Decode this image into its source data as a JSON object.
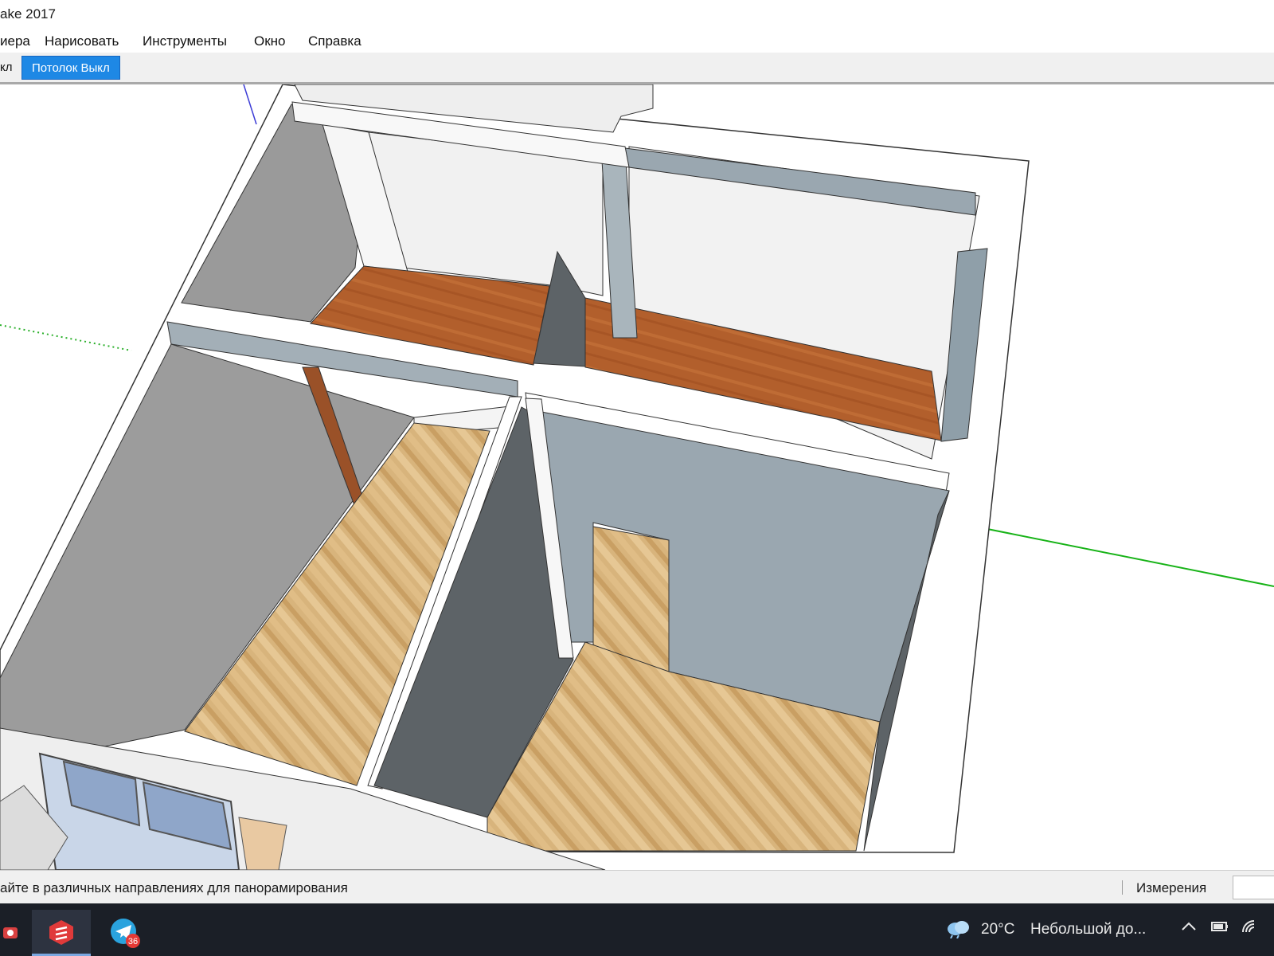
{
  "window": {
    "title": "ake 2017"
  },
  "menu": [
    {
      "label": "иера"
    },
    {
      "label": "Нарисовать"
    },
    {
      "label": "Инструменты"
    },
    {
      "label": "Окно"
    },
    {
      "label": "Справка"
    }
  ],
  "toolbar": {
    "items": [
      {
        "label": "кл"
      },
      {
        "label": "Потолок Выкл"
      }
    ]
  },
  "viewport": {
    "colors": {
      "floor_oak": "#d8b47c",
      "floor_cherry": "#b25f2c",
      "wall_top": "#ffffff",
      "wall_gray": "#9c9c9c",
      "wall_blue": "#9aa7b0",
      "wall_dark": "#5d6367",
      "axis_green": "#17b317"
    }
  },
  "status": {
    "hint": "айте в различных направлениях для панорамирования",
    "measurements_label": "Измерения",
    "measurements_value": ""
  },
  "taskbar": {
    "weather_temp": "20°C",
    "weather_text": "Небольшой до...",
    "telegram_badge": "36",
    "icons": [
      "camera-app-icon",
      "sketchup-icon",
      "telegram-icon",
      "weather-cloud-icon",
      "chevron-up-icon",
      "battery-icon",
      "wifi-icon"
    ]
  }
}
